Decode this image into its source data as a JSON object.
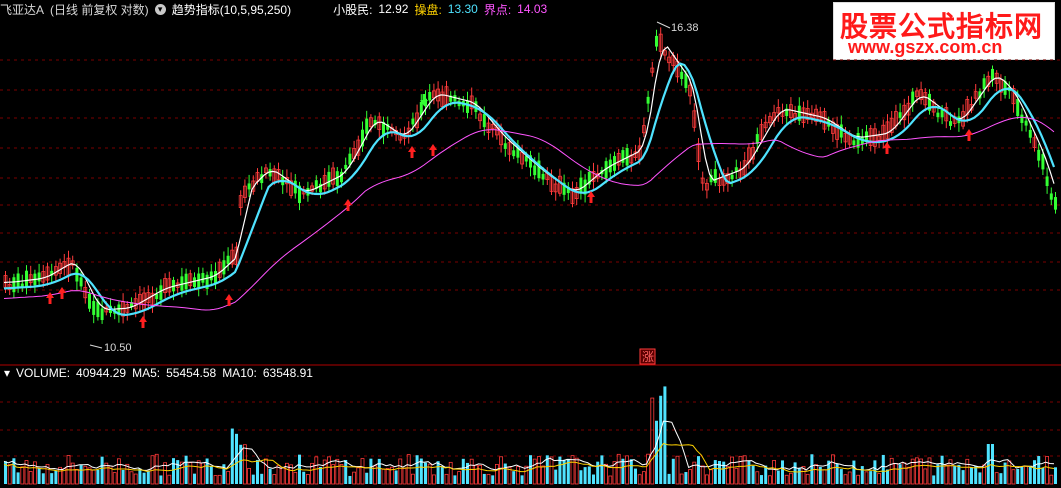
{
  "header": {
    "stock_name": "飞亚达A",
    "mode": "(日线 前复权 对数)",
    "indicator": "趋势指标(10,5,95,250)",
    "xiaogu_label": "小股民:",
    "xiaogu_value": "12.92",
    "caopan_label": "操盘:",
    "caopan_value": "13.30",
    "jiedian_label": "界点:",
    "jiedian_value": "14.03"
  },
  "watermark": {
    "line1": "股票公式指标网",
    "line2": "www.gszx.com.cn"
  },
  "annotations": {
    "high": "16.38",
    "low": "10.50",
    "zhang": "涨"
  },
  "volume": {
    "label": "VOLUME:",
    "value": "40944.29",
    "ma5_label": "MA5:",
    "ma5_value": "55454.58",
    "ma10_label": "MA10:",
    "ma10_value": "63548.91"
  },
  "colors": {
    "background": "#000000",
    "up": "#ff3b3b",
    "down": "#33ff33",
    "line_cyan": "#4fe3ff",
    "line_white": "#ffffff",
    "line_magenta": "#ff55ff",
    "grid": "#8b0000"
  }
}
